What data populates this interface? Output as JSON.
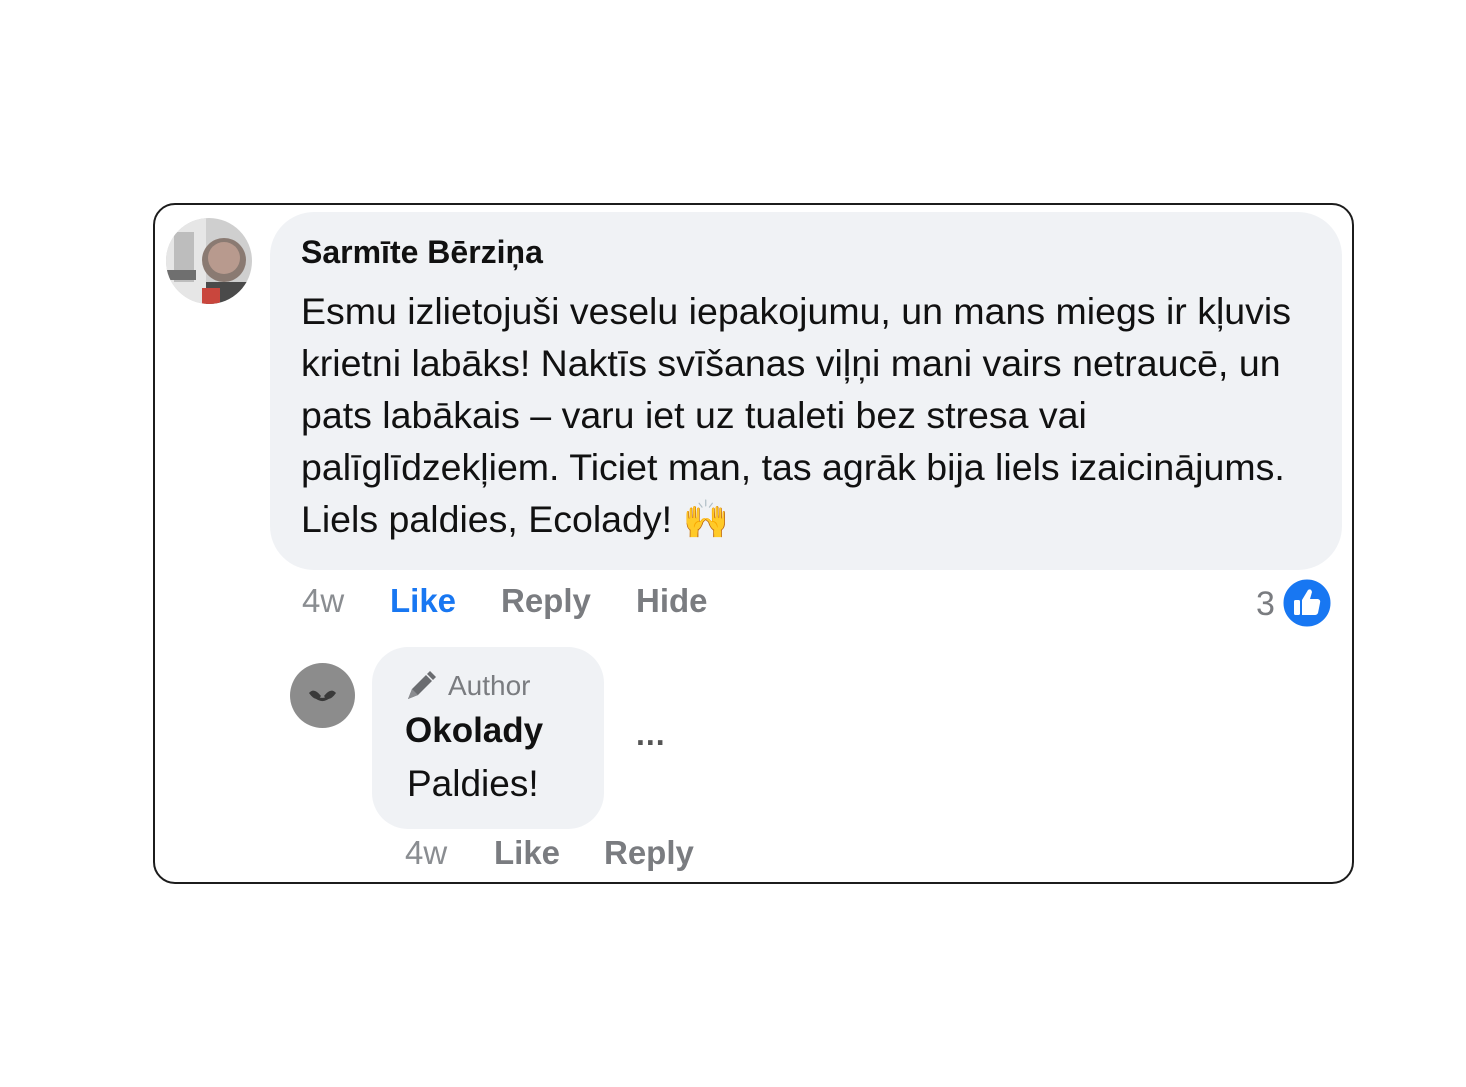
{
  "comment": {
    "author": "Sarmīte Bērziņa",
    "text": "Esmu izlietojuši veselu iepakojumu, un mans miegs ir kļuvis krietni labāks! Naktīs svīšanas viļņi mani vairs netraucē, un pats labākais – varu iet uz tualeti bez stresa vai palīglīdzekļiem. Ticiet man, tas agrāk bija liels izaicinājums. Liels paldies, Ecolady!",
    "emoji": "🙌",
    "time": "4w",
    "actions": {
      "like": "Like",
      "reply": "Reply",
      "hide": "Hide"
    },
    "like_count": "3",
    "like_icon": "thumbs-up-icon"
  },
  "reply": {
    "badge": "Author",
    "badge_icon": "pen-icon",
    "author": "Okolady",
    "text": "Paldies!",
    "more": "...",
    "time": "4w",
    "actions": {
      "like": "Like",
      "reply": "Reply"
    }
  },
  "colors": {
    "accent": "#1877f2",
    "bubble": "#f0f2f5",
    "muted": "#7a7c80",
    "text": "#111111"
  }
}
